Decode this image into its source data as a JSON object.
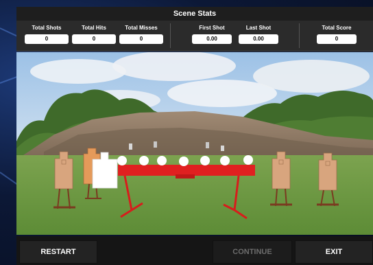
{
  "stats": {
    "title": "Scene Stats",
    "items": [
      {
        "label": "Total Shots",
        "value": "0"
      },
      {
        "label": "Total Hits",
        "value": "0"
      },
      {
        "label": "Total Misses",
        "value": "0"
      },
      {
        "label": "First Shot",
        "value": "0.00"
      },
      {
        "label": "Last Shot",
        "value": "0.00"
      },
      {
        "label": "Total Score",
        "value": "0"
      }
    ]
  },
  "buttons": {
    "restart": "RESTART",
    "continue": "CONTINUE",
    "exit": "EXIT"
  },
  "colors": {
    "target_tan": "#d8a57e",
    "target_orange": "#e59a5a",
    "rack_red": "#e02020",
    "plate_white": "#ffffff",
    "grass": "#6a9a3f"
  }
}
